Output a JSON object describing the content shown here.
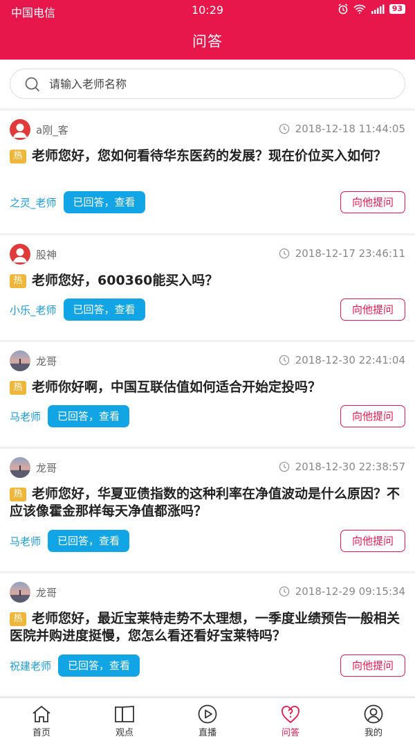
{
  "status_bar": {
    "carrier": "中国电信",
    "time": "10:29",
    "battery": "93"
  },
  "header": {
    "title": "问答"
  },
  "search": {
    "placeholder": "请输入老师名称"
  },
  "questions": [
    {
      "username": "a刚_客",
      "time": "2018-12-18 11:44:05",
      "hot_label": "热",
      "text": "老师您好，您如何看待华东医药的发展？现在价位买入如何？",
      "teacher": "之灵_老师",
      "answered_label": "已回答，查看",
      "ask_label": "向他提问"
    },
    {
      "username": "股神",
      "time": "2018-12-17 23:46:11",
      "hot_label": "热",
      "text": "老师您好，600360能买入吗？",
      "teacher": "小乐_老师",
      "answered_label": "已回答，查看",
      "ask_label": "向他提问"
    },
    {
      "username": "龙哥",
      "time": "2018-12-30 22:41:04",
      "hot_label": "热",
      "text": "老师你好啊，中国互联估值如何适合开始定投吗？",
      "teacher": "马老师",
      "answered_label": "已回答，查看",
      "ask_label": "向他提问"
    },
    {
      "username": "龙哥",
      "time": "2018-12-30 22:38:57",
      "hot_label": "热",
      "text": "老师您好，华夏亚债指数的这种利率在净值波动是什么原因？不应该像霍金那样每天净值都涨吗？",
      "teacher": "马老师",
      "answered_label": "已回答，查看",
      "ask_label": "向他提问"
    },
    {
      "username": "龙哥",
      "time": "2018-12-29 09:15:34",
      "hot_label": "热",
      "text": "老师您好，最近宝莱特走势不太理想，一季度业绩预告一般相关医院并购进度挺慢，您怎么看还看好宝莱特吗？",
      "teacher": "祝建老师",
      "answered_label": "已回答，查看",
      "ask_label": "向他提问"
    }
  ],
  "tabbar": {
    "items": [
      {
        "label": "首页",
        "icon": "home-icon"
      },
      {
        "label": "观点",
        "icon": "book-icon"
      },
      {
        "label": "直播",
        "icon": "play-icon"
      },
      {
        "label": "问答",
        "icon": "qa-icon",
        "active": true
      },
      {
        "label": "我的",
        "icon": "user-icon"
      }
    ]
  },
  "colors": {
    "brand": "#e8174b",
    "accent_blue": "#12a5e6",
    "teacher_blue": "#1a9bd7",
    "hot": "#f0b63a"
  }
}
